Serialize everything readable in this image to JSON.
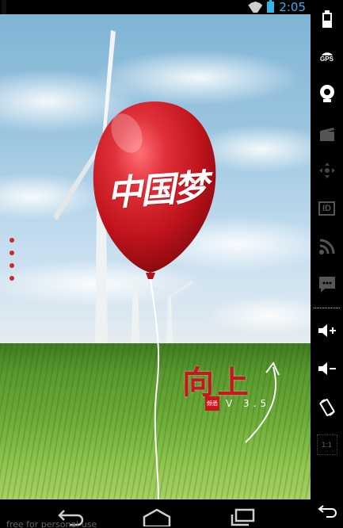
{
  "status_bar": {
    "time": "2:05",
    "icons": [
      "wifi-icon",
      "battery-icon"
    ],
    "accent": "#33b5e5"
  },
  "screen": {
    "balloon_text": "中国梦",
    "title": "向上",
    "brand_logo_text": "频悉",
    "version": "V 3.5",
    "page_indicator": {
      "count": 4,
      "color": "#d0262c"
    },
    "brand_color": "#c8161d"
  },
  "side_panel": {
    "icons": [
      "battery-icon",
      "gps-icon",
      "camera-icon",
      "clapper-icon",
      "dpad-icon",
      "id-icon",
      "rss-icon",
      "sms-icon",
      "volume-up-icon",
      "volume-down-icon",
      "rotate-icon",
      "scale-icon",
      "back-icon"
    ],
    "gps_label": "GPS",
    "id_label": "ID",
    "scale_label": "1:1"
  },
  "nav_bar": {
    "icons": [
      "back-icon",
      "home-icon",
      "recents-icon"
    ]
  },
  "watermark": "free for personal use"
}
